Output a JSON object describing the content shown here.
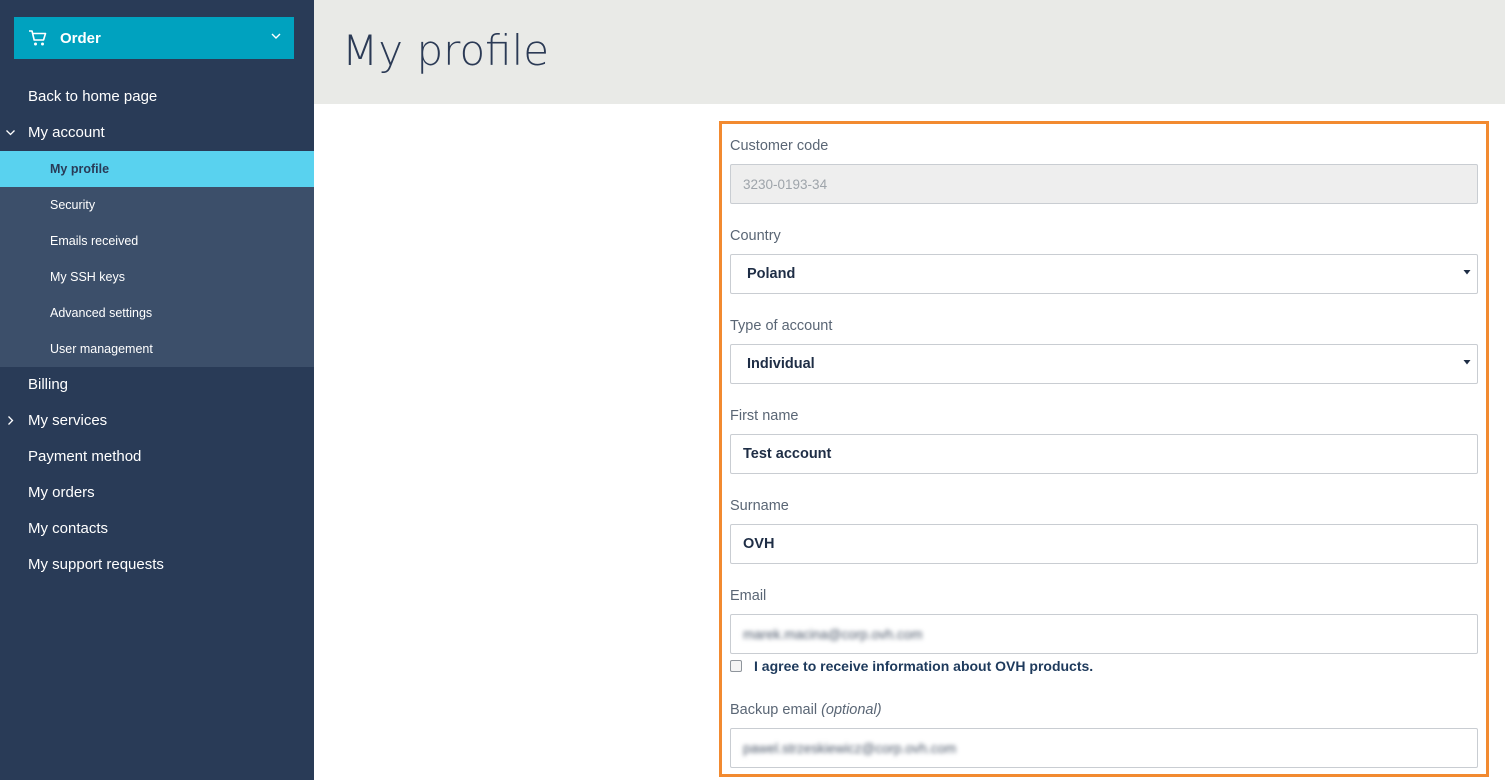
{
  "sidebar": {
    "order_label": "Order",
    "order_icon": "cart-icon",
    "items": [
      {
        "label": "Back to home page"
      },
      {
        "label": "My account",
        "expanded": true
      },
      {
        "label": "Billing"
      },
      {
        "label": "My services",
        "expanded": false
      },
      {
        "label": "Payment method"
      },
      {
        "label": "My orders"
      },
      {
        "label": "My contacts"
      },
      {
        "label": "My support requests"
      }
    ],
    "subitems": [
      {
        "label": "My profile",
        "active": true
      },
      {
        "label": "Security"
      },
      {
        "label": "Emails received"
      },
      {
        "label": "My SSH keys"
      },
      {
        "label": "Advanced settings"
      },
      {
        "label": "User management"
      }
    ]
  },
  "header": {
    "title": "My profile"
  },
  "form": {
    "customer_code": {
      "label": "Customer code",
      "value": "3230-0193-34"
    },
    "country": {
      "label": "Country",
      "value": "Poland"
    },
    "account_type": {
      "label": "Type of account",
      "value": "Individual"
    },
    "first_name": {
      "label": "First name",
      "value": "Test account"
    },
    "surname": {
      "label": "Surname",
      "value": "OVH"
    },
    "email": {
      "label": "Email",
      "value": "marek.macina@corp.ovh.com"
    },
    "consent": {
      "label": "I agree to receive information about OVH products.",
      "checked": false
    },
    "backup_email": {
      "label": "Backup email",
      "label_optional": "(optional)",
      "value": "pawel.strzeskiewicz@corp.ovh.com"
    }
  },
  "colors": {
    "sidebar_bg": "#293b57",
    "submenu_bg": "#3c4f6a",
    "active_bg": "#59d2ef",
    "order_bg": "#00a2bf",
    "highlight_border": "#f28a30",
    "header_bg": "#e9eae7"
  }
}
